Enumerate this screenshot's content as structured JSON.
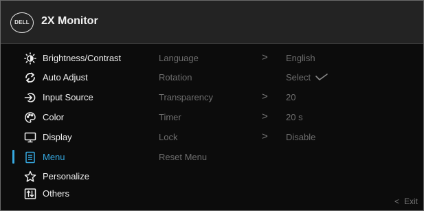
{
  "header": {
    "logo_text": "DELL",
    "title": "2X Monitor"
  },
  "menu": {
    "items": [
      {
        "label": "Brightness/Contrast",
        "icon": "brightness-icon"
      },
      {
        "label": "Auto Adjust",
        "icon": "auto-adjust-icon"
      },
      {
        "label": "Input Source",
        "icon": "input-source-icon"
      },
      {
        "label": "Color",
        "icon": "color-palette-icon"
      },
      {
        "label": "Display",
        "icon": "display-monitor-icon"
      },
      {
        "label": "Menu",
        "icon": "menu-list-icon",
        "active": true
      },
      {
        "label": "Personalize",
        "icon": "star-icon"
      },
      {
        "label": "Others",
        "icon": "others-icon"
      }
    ]
  },
  "submenu": {
    "rows": [
      {
        "label": "Language",
        "arrow": ">",
        "value": "English"
      },
      {
        "label": "Rotation",
        "arrow": "",
        "value": "Select"
      },
      {
        "label": "Transparency",
        "arrow": ">",
        "value": "20"
      },
      {
        "label": "Timer",
        "arrow": ">",
        "value": "20 s"
      },
      {
        "label": "Lock",
        "arrow": ">",
        "value": "Disable"
      },
      {
        "label": "Reset Menu",
        "arrow": "",
        "value": ""
      }
    ]
  },
  "footer": {
    "exit_label": "Exit",
    "exit_chevron": "<"
  },
  "colors": {
    "accent": "#36a9e1",
    "background": "#0c0c0c",
    "header": "#232323",
    "text": "#f0f0f0",
    "dim_text": "#6f6f6f"
  }
}
